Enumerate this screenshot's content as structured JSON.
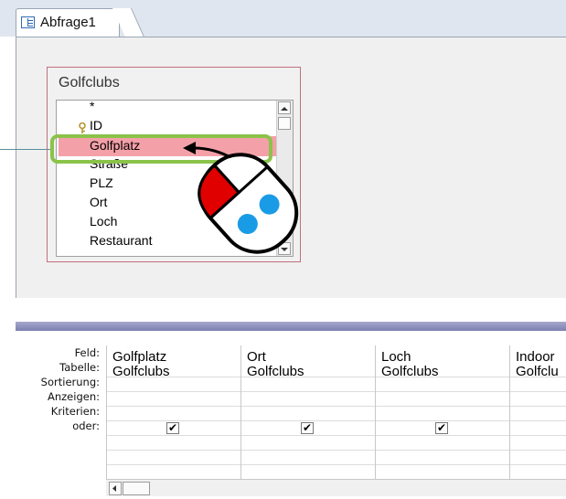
{
  "tab": {
    "label": "Abfrage1"
  },
  "table_box": {
    "title": "Golfclubs",
    "fields": [
      "*",
      "ID",
      "Golfplatz",
      "Straße",
      "PLZ",
      "Ort",
      "Loch",
      "Restaurant"
    ],
    "highlighted": "Golfplatz",
    "key_field": "ID"
  },
  "grid": {
    "row_labels": [
      "Feld:",
      "Tabelle:",
      "Sortierung:",
      "Anzeigen:",
      "Kriterien:",
      "oder:"
    ],
    "columns": [
      {
        "field": "Golfplatz",
        "table": "Golfclubs",
        "show": true
      },
      {
        "field": "Ort",
        "table": "Golfclubs",
        "show": true
      },
      {
        "field": "Loch",
        "table": "Golfclubs",
        "show": true
      },
      {
        "field": "Indoor",
        "table": "Golfclu",
        "show": false
      }
    ],
    "checkmark": "✔"
  },
  "colors": {
    "highlight": "#f4a0a8",
    "callout_border": "#8bc34a",
    "mouse_left_button": "#e00000",
    "mouse_dots": "#1a9be6"
  },
  "icons": {
    "tab": "query-design-icon",
    "key": "primary-key-icon",
    "mouse": "mouse-icon",
    "arrow": "drag-arrow-icon"
  }
}
